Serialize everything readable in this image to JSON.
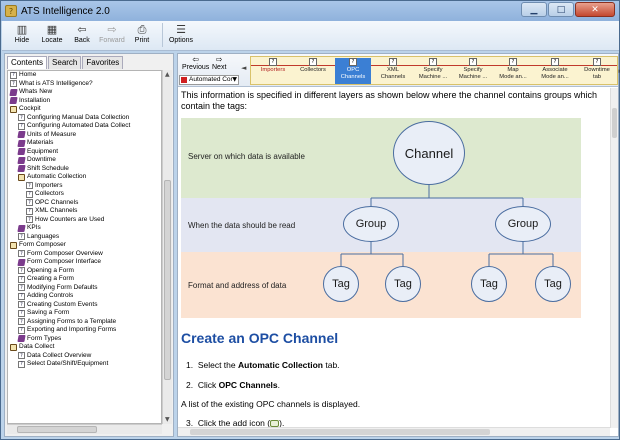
{
  "window": {
    "title": "ATS Intelligence 2.0",
    "colors": {
      "accent": "#1d4ea3",
      "active_tab": "#3b7fd4"
    }
  },
  "toolbar": {
    "hide": "Hide",
    "locate": "Locate",
    "back": "Back",
    "forward": "Forward",
    "print": "Print",
    "options": "Options"
  },
  "left_tabs": {
    "contents": "Contents",
    "search": "Search",
    "favorites": "Favorites"
  },
  "tree": [
    {
      "label": "Home",
      "icon": "page",
      "level": 0
    },
    {
      "label": "What is ATS Intelligence?",
      "icon": "page",
      "level": 0
    },
    {
      "label": "Whats New",
      "icon": "book",
      "level": 0
    },
    {
      "label": "Installation",
      "icon": "book",
      "level": 0
    },
    {
      "label": "Cockpit",
      "icon": "open",
      "level": 0
    },
    {
      "label": "Configuring Manual Data Collection",
      "icon": "page",
      "level": 1
    },
    {
      "label": "Configuring Automated Data Collect",
      "icon": "page",
      "level": 1
    },
    {
      "label": "Units of Measure",
      "icon": "book",
      "level": 1
    },
    {
      "label": "Materials",
      "icon": "book",
      "level": 1
    },
    {
      "label": "Equipment",
      "icon": "book",
      "level": 1
    },
    {
      "label": "Downtime",
      "icon": "book",
      "level": 1
    },
    {
      "label": "Shift Schedule",
      "icon": "book",
      "level": 1
    },
    {
      "label": "Automatic Collection",
      "icon": "open",
      "level": 1
    },
    {
      "label": "Importers",
      "icon": "page",
      "level": 2
    },
    {
      "label": "Collectors",
      "icon": "page",
      "level": 2
    },
    {
      "label": "OPC Channels",
      "icon": "page",
      "level": 2
    },
    {
      "label": "XML Channels",
      "icon": "page",
      "level": 2
    },
    {
      "label": "How Counters are Used",
      "icon": "page",
      "level": 2
    },
    {
      "label": "KPIs",
      "icon": "book",
      "level": 1
    },
    {
      "label": "Languages",
      "icon": "page",
      "level": 1
    },
    {
      "label": "Form Composer",
      "icon": "open",
      "level": 0
    },
    {
      "label": "Form Composer Overview",
      "icon": "page",
      "level": 1
    },
    {
      "label": "Form Composer Interface",
      "icon": "book",
      "level": 1
    },
    {
      "label": "Opening a Form",
      "icon": "page",
      "level": 1
    },
    {
      "label": "Creating a Form",
      "icon": "page",
      "level": 1
    },
    {
      "label": "Modifying Form Defaults",
      "icon": "page",
      "level": 1
    },
    {
      "label": "Adding Controls",
      "icon": "page",
      "level": 1
    },
    {
      "label": "Creating Custom Events",
      "icon": "page",
      "level": 1
    },
    {
      "label": "Saving a Form",
      "icon": "page",
      "level": 1
    },
    {
      "label": "Assigning Forms to a Template",
      "icon": "page",
      "level": 1
    },
    {
      "label": "Exporting and Importing Forms",
      "icon": "page",
      "level": 1
    },
    {
      "label": "Form Types",
      "icon": "book",
      "level": 1
    },
    {
      "label": "Data Collect",
      "icon": "open",
      "level": 0
    },
    {
      "label": "Data Collect Overview",
      "icon": "page",
      "level": 1
    },
    {
      "label": "Select Date/Shift/Equipment",
      "icon": "page",
      "level": 1
    }
  ],
  "nav": {
    "previous": "Previous",
    "next": "Next",
    "dropdown": "Automated Cor"
  },
  "strip_tabs": [
    {
      "label": "Importers",
      "red": true
    },
    {
      "label": "Collectors",
      "red": false
    },
    {
      "label": "OPC\nChannels",
      "active": true
    },
    {
      "label": "XML\nChannels"
    },
    {
      "label": "Specify\nMachine ..."
    },
    {
      "label": "Specify\nMachine ..."
    },
    {
      "label": "Map\nMode an..."
    },
    {
      "label": "Associate\nMode an..."
    },
    {
      "label": "Downtime\ntab"
    }
  ],
  "content": {
    "intro": "This information is specified in different layers as shown below where the channel contains groups which contain the tags:",
    "diagram": {
      "band1": "Server on which data is available",
      "band2": "When the data should be read",
      "band3": "Format and address of data",
      "channel": "Channel",
      "group1": "Group",
      "group2": "Group",
      "tag1": "Tag",
      "tag2": "Tag",
      "tag3": "Tag",
      "tag4": "Tag",
      "band_colors": [
        "#dde9cf",
        "#e3e6f2",
        "#fbe3d2"
      ]
    },
    "heading": "Create an OPC Channel",
    "step1_pre": "Select the ",
    "step1_bold": "Automatic Collection",
    "step1_post": " tab.",
    "step2_pre": "Click ",
    "step2_bold": "OPC Channels",
    "step2_post": ".",
    "after": "A list of the existing OPC channels is displayed.",
    "step3": "Click the add icon (",
    "step3_post": ")."
  }
}
